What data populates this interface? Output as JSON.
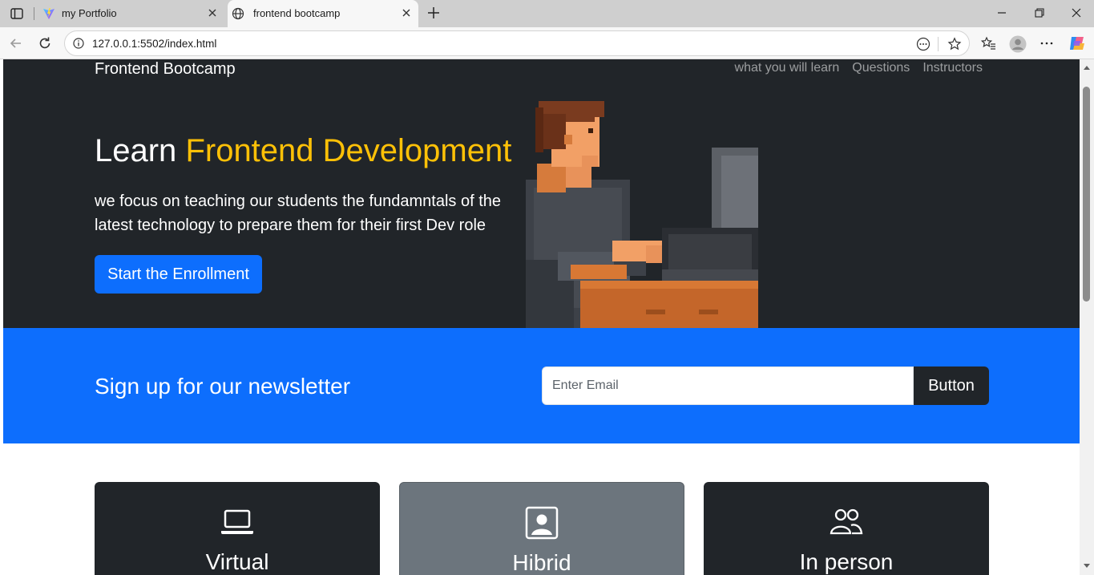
{
  "browser": {
    "tabs": [
      {
        "title": "my Portfolio",
        "active": false
      },
      {
        "title": "frontend bootcamp",
        "active": true
      }
    ],
    "url": "127.0.0.1:5502/index.html"
  },
  "site": {
    "brand": "Frontend Bootcamp",
    "nav": [
      "what you will learn",
      "Questions",
      "Instructors"
    ]
  },
  "hero": {
    "title_prefix": "Learn",
    "title_accent": "Frontend Development",
    "text": "we focus on teaching our students the fundamntals of the latest technology to prepare them for their first Dev role",
    "button": "Start the Enrollment"
  },
  "newsletter": {
    "title": "Sign up for our newsletter",
    "placeholder": "Enter Email",
    "button": "Button"
  },
  "cards": [
    {
      "title": "Virtual",
      "icon": "laptop-icon"
    },
    {
      "title": "Hibrid",
      "icon": "person-badge-icon"
    },
    {
      "title": "In person",
      "icon": "people-icon"
    }
  ],
  "colors": {
    "dark": "#212529",
    "primary": "#0d6efd",
    "warning": "#ffc107",
    "secondary": "#6c757d"
  }
}
